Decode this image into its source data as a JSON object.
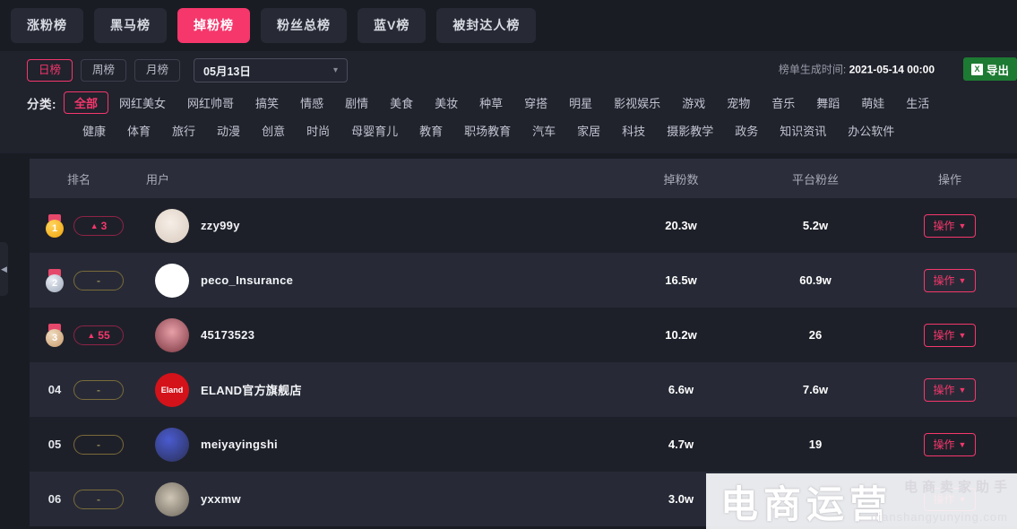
{
  "top_tabs": [
    {
      "label": "涨粉榜",
      "active": false
    },
    {
      "label": "黑马榜",
      "active": false
    },
    {
      "label": "掉粉榜",
      "active": true
    },
    {
      "label": "粉丝总榜",
      "active": false
    },
    {
      "label": "蓝V榜",
      "active": false
    },
    {
      "label": "被封达人榜",
      "active": false
    }
  ],
  "period_tabs": [
    {
      "label": "日榜",
      "active": true
    },
    {
      "label": "周榜",
      "active": false
    },
    {
      "label": "月榜",
      "active": false
    }
  ],
  "date_picker": {
    "value": "05月13日",
    "caret": "chevron-down-icon"
  },
  "generated": {
    "label": "榜单生成时间:",
    "time": "2021-05-14 00:00"
  },
  "export": {
    "label": "导出",
    "icon_text": "X",
    "color": "#1d7a33"
  },
  "categories": {
    "label": "分类:",
    "row1": [
      "全部",
      "网红美女",
      "网红帅哥",
      "搞笑",
      "情感",
      "剧情",
      "美食",
      "美妆",
      "种草",
      "穿搭",
      "明星",
      "影视娱乐",
      "游戏",
      "宠物",
      "音乐",
      "舞蹈",
      "萌娃",
      "生活"
    ],
    "row2": [
      "健康",
      "体育",
      "旅行",
      "动漫",
      "创意",
      "时尚",
      "母婴育儿",
      "教育",
      "职场教育",
      "汽车",
      "家居",
      "科技",
      "摄影教学",
      "政务",
      "知识资讯",
      "办公软件"
    ],
    "selected": "全部"
  },
  "table": {
    "headers": {
      "rank": "排名",
      "user": "用户",
      "drop": "掉粉数",
      "fans": "平台粉丝",
      "action": "操作"
    },
    "action_label": "操作",
    "rows": [
      {
        "rank": "1",
        "medal": "gold",
        "change": "3",
        "change_type": "up",
        "name": "zzy99y",
        "avatar_bg": "radial-gradient(circle at 45% 40%, #f6efe7, #d9c9bd)",
        "avatar_text": "",
        "drop": "20.3w",
        "fans": "5.2w"
      },
      {
        "rank": "2",
        "medal": "silver",
        "change": "-",
        "change_type": "flat",
        "name": "peco_Insurance",
        "avatar_bg": "#ffffff",
        "avatar_text": "",
        "drop": "16.5w",
        "fans": "60.9w"
      },
      {
        "rank": "3",
        "medal": "bronze",
        "change": "55",
        "change_type": "up",
        "name": "45173523",
        "avatar_bg": "radial-gradient(circle at 50% 40%, #e8a0a8, #7a3640)",
        "avatar_text": "",
        "drop": "10.2w",
        "fans": "26"
      },
      {
        "rank": "04",
        "medal": "none",
        "change": "-",
        "change_type": "flat",
        "name": "ELAND官方旗舰店",
        "avatar_bg": "#d4121a",
        "avatar_text": "Eland",
        "drop": "6.6w",
        "fans": "7.6w"
      },
      {
        "rank": "05",
        "medal": "none",
        "change": "-",
        "change_type": "flat",
        "name": "meiyayingshi",
        "avatar_bg": "radial-gradient(circle at 40% 35%, #4a5bd0, #2a2f55)",
        "avatar_text": "",
        "drop": "4.7w",
        "fans": "19"
      },
      {
        "rank": "06",
        "medal": "none",
        "change": "-",
        "change_type": "flat",
        "name": "yxxmw",
        "avatar_bg": "radial-gradient(circle at 45% 45%, #cfc6b6, #6a6358)",
        "avatar_text": "",
        "drop": "3.0w",
        "fans": ""
      }
    ]
  },
  "watermark": {
    "main": "电商运营",
    "sub": "电商卖家助手",
    "url": "dianshangyunying.com"
  },
  "colors": {
    "accent": "#f5376c",
    "panel": "#20222c",
    "page": "#1a1c24",
    "row_odd": "#1e2029",
    "row_even": "#272a36"
  }
}
